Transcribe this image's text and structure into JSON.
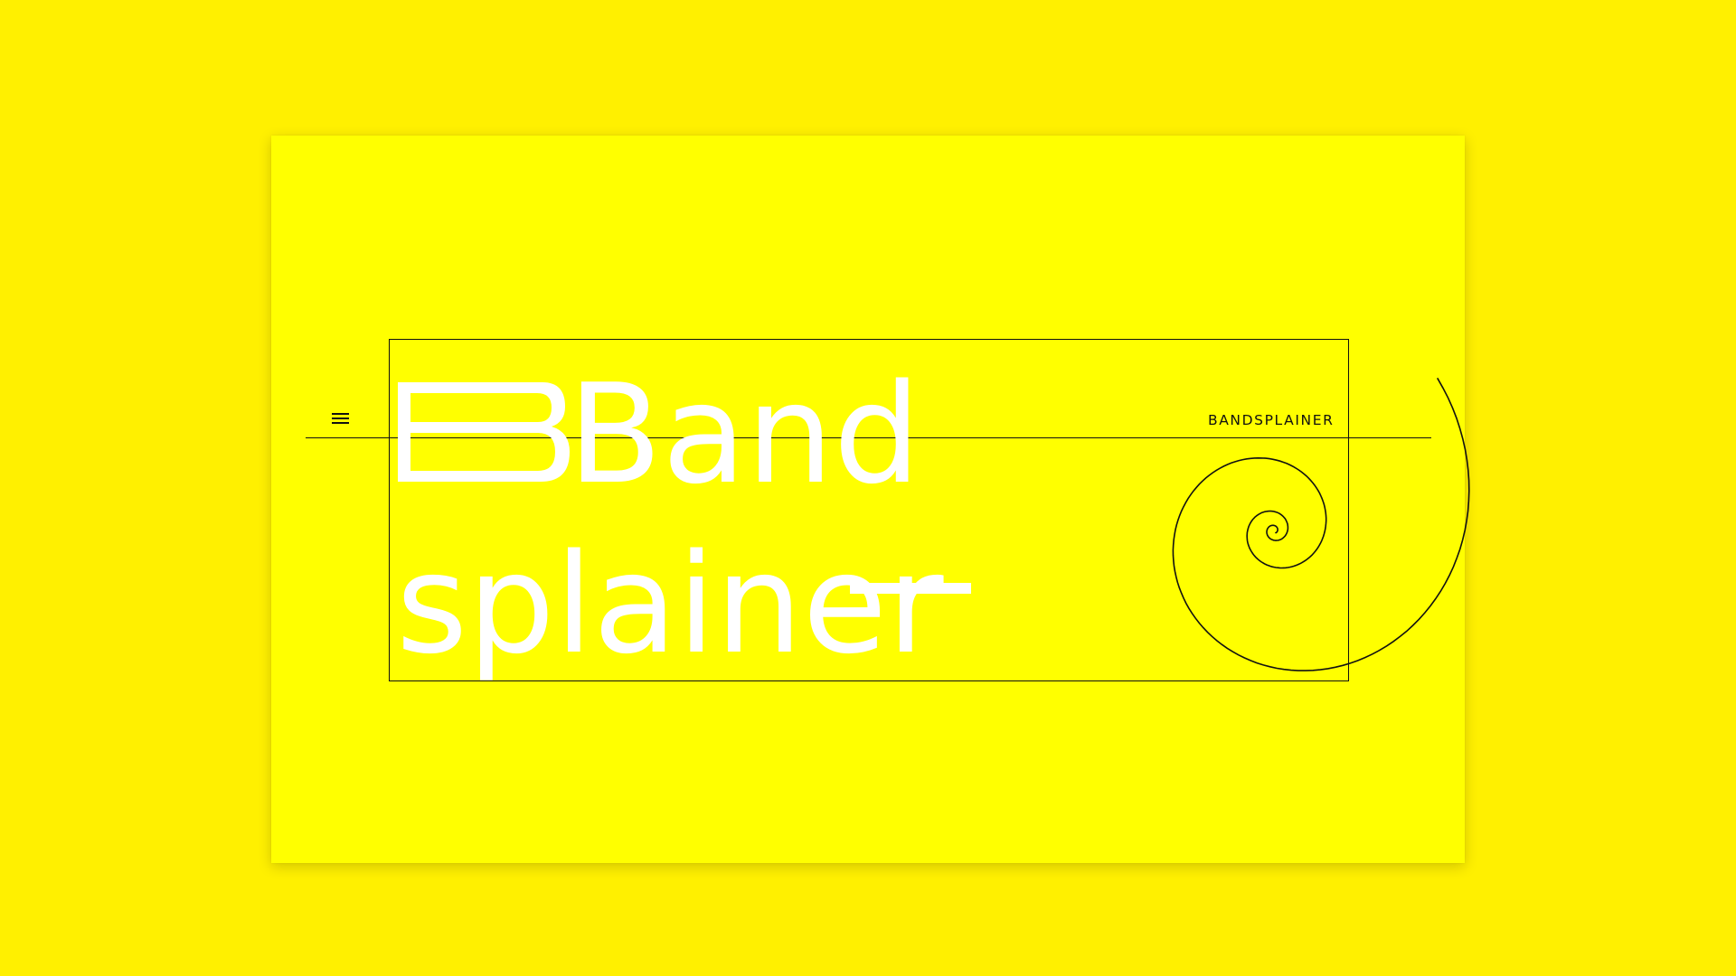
{
  "header": {
    "menu_icon": "hamburger-menu-icon",
    "brand": "BANDSPLAINER"
  },
  "hero": {
    "title_line1": "Band",
    "title_line2": "splainer"
  },
  "decorations": {
    "spiral_icon": "spiral-icon"
  },
  "colors": {
    "page_background": "#FFF000",
    "card_background": "#FFFF00",
    "title_text": "#FFFFFF",
    "lines": "#111111"
  }
}
